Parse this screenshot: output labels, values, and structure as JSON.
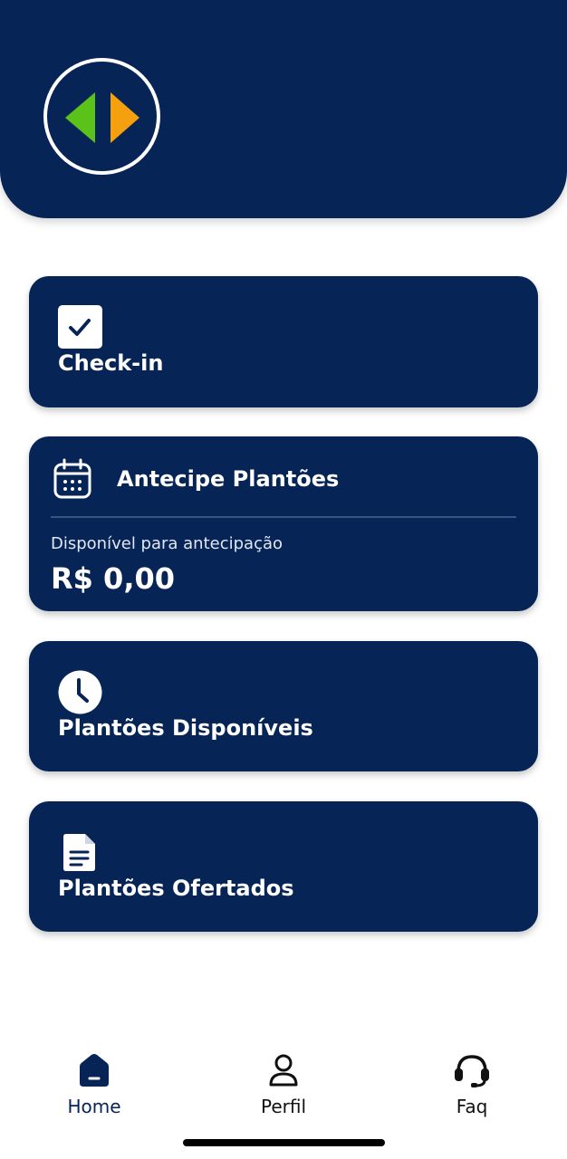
{
  "colors": {
    "brand_navy": "#062456",
    "logo_green": "#5bc21a",
    "logo_orange": "#f5a00e",
    "white": "#ffffff"
  },
  "header": {
    "logo_icon": "app-logo-arrows-icon"
  },
  "cards": {
    "checkin": {
      "title": "Check-in",
      "icon": "checkbox-icon"
    },
    "antecipe": {
      "title": "Antecipe Plantões",
      "icon": "calendar-icon",
      "subtitle": "Disponível para antecipação",
      "value": "R$ 0,00"
    },
    "disponiveis": {
      "title": "Plantões Disponíveis",
      "icon": "clock-icon"
    },
    "ofertados": {
      "title": "Plantões Ofertados",
      "icon": "document-icon"
    }
  },
  "nav": {
    "items": [
      {
        "label": "Home",
        "icon": "home-icon",
        "active": true
      },
      {
        "label": "Perfil",
        "icon": "user-icon",
        "active": false
      },
      {
        "label": "Faq",
        "icon": "headset-icon",
        "active": false
      }
    ]
  }
}
